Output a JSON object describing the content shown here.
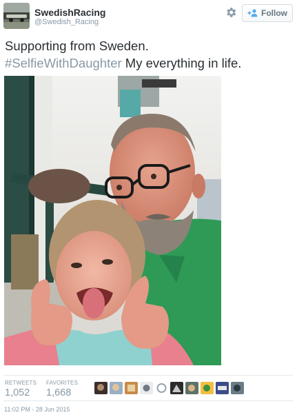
{
  "author": {
    "display_name": "SwedishRacing",
    "screen_name": "@Swedish_Racing",
    "avatar_icon": "avatar"
  },
  "actions": {
    "settings_icon": "gear-icon",
    "follow_label": "Follow",
    "follow_icon": "add-user-icon"
  },
  "tweet": {
    "line1": "Supporting from Sweden.",
    "hashtag": "#SelfieWithDaughter",
    "line2_rest": " My everything in life."
  },
  "stats": {
    "retweets_label": "RETWEETS",
    "retweets_count": "1,052",
    "favorites_label": "FAVORITES",
    "favorites_count": "1,668"
  },
  "timestamp": "11:02 PM - 28 Jun 2015",
  "colors": {
    "text": "#292f33",
    "muted": "#8899a6",
    "border": "#e1e8ed",
    "photo_green_shirt": "#2e9a55",
    "photo_pink_sweater": "#e8808e"
  }
}
